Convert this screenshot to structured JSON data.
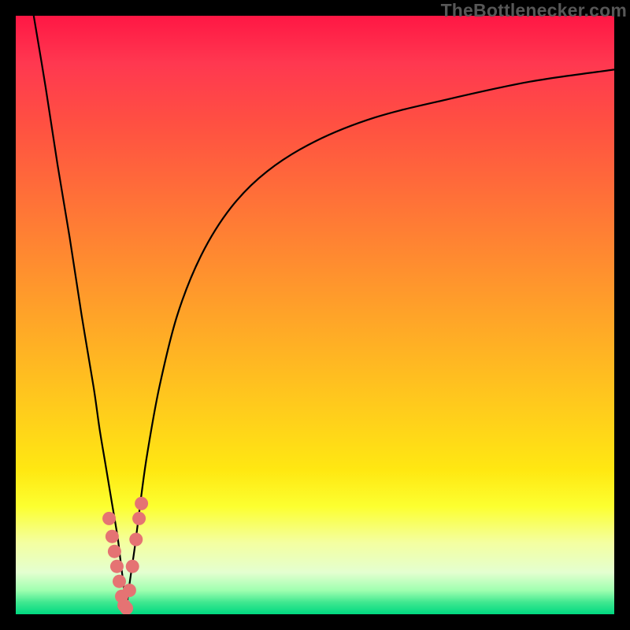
{
  "watermark": "TheBottlenecker.com",
  "colors": {
    "curve_stroke": "#000000",
    "marker_fill": "#e57373",
    "marker_stroke": "#c75a5a"
  },
  "chart_data": {
    "type": "line",
    "title": "",
    "xlabel": "",
    "ylabel": "",
    "xlim": [
      0,
      100
    ],
    "ylim": [
      0,
      100
    ],
    "series": [
      {
        "name": "left_branch",
        "x": [
          3,
          5,
          7,
          9,
          11,
          13,
          14,
          15,
          16,
          17,
          17.5,
          18,
          18.5
        ],
        "y": [
          100,
          88,
          75,
          63,
          50,
          38,
          31,
          25,
          19,
          13,
          9,
          5,
          1
        ]
      },
      {
        "name": "right_branch",
        "x": [
          18.5,
          19,
          20,
          21,
          22,
          24,
          27,
          31,
          36,
          42,
          50,
          60,
          72,
          86,
          100
        ],
        "y": [
          1,
          5,
          12,
          20,
          27,
          38,
          50,
          60,
          68,
          74,
          79,
          83,
          86,
          89,
          91
        ]
      }
    ],
    "markers": {
      "name": "cluster",
      "x": [
        15.6,
        16.1,
        16.5,
        16.9,
        17.3,
        17.7,
        18.1,
        18.5,
        19.0,
        19.5,
        20.1,
        20.6,
        21.0
      ],
      "y": [
        16.0,
        13.0,
        10.5,
        8.0,
        5.5,
        3.0,
        1.5,
        1.0,
        4.0,
        8.0,
        12.5,
        16.0,
        18.5
      ]
    }
  }
}
